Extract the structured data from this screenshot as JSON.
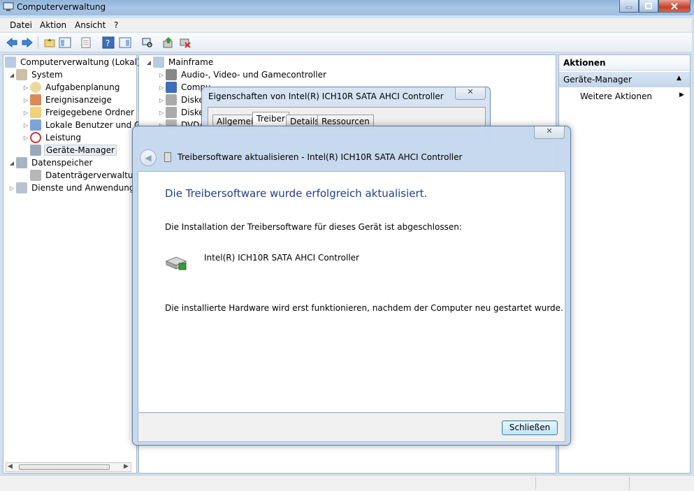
{
  "window": {
    "title": "Computerverwaltung"
  },
  "menu": {
    "items": [
      "Datei",
      "Aktion",
      "Ansicht",
      "?"
    ]
  },
  "tree": {
    "root": "Computerverwaltung (Lokal)",
    "system": "System",
    "aufgabenplanung": "Aufgabenplanung",
    "ereignisanzeige": "Ereignisanzeige",
    "freigegebene_ordner": "Freigegebene Ordner",
    "lokale_benutzer": "Lokale Benutzer und Gr",
    "leistung": "Leistung",
    "geraete_manager": "Geräte-Manager",
    "datenspeicher": "Datenspeicher",
    "datentraeger": "Datenträgerverwaltung",
    "dienste": "Dienste und Anwendungen"
  },
  "devices": {
    "root": "Mainframe",
    "audio": "Audio-, Video- und Gamecontroller",
    "computer": "Compu",
    "disk1": "Diske",
    "disk2": "Diske",
    "dvd": "DVD/"
  },
  "actions": {
    "header": "Aktionen",
    "section": "Geräte-Manager",
    "more": "Weitere Aktionen"
  },
  "properties_dialog": {
    "title": "Eigenschaften von Intel(R) ICH10R SATA AHCI Controller",
    "tabs": [
      "Allgemein",
      "Treiber",
      "Details",
      "Ressourcen"
    ],
    "active_tab": "Treiber"
  },
  "wizard": {
    "title": "Treibersoftware aktualisieren - Intel(R) ICH10R SATA AHCI Controller",
    "heading": "Die Treibersoftware wurde erfolgreich aktualisiert.",
    "info": "Die Installation der Treibersoftware für dieses Gerät ist abgeschlossen:",
    "device": "Intel(R) ICH10R SATA AHCI Controller",
    "restart": "Die installierte Hardware wird erst funktionieren, nachdem der Computer neu gestartet wurde.",
    "close_label": "Schließen"
  }
}
